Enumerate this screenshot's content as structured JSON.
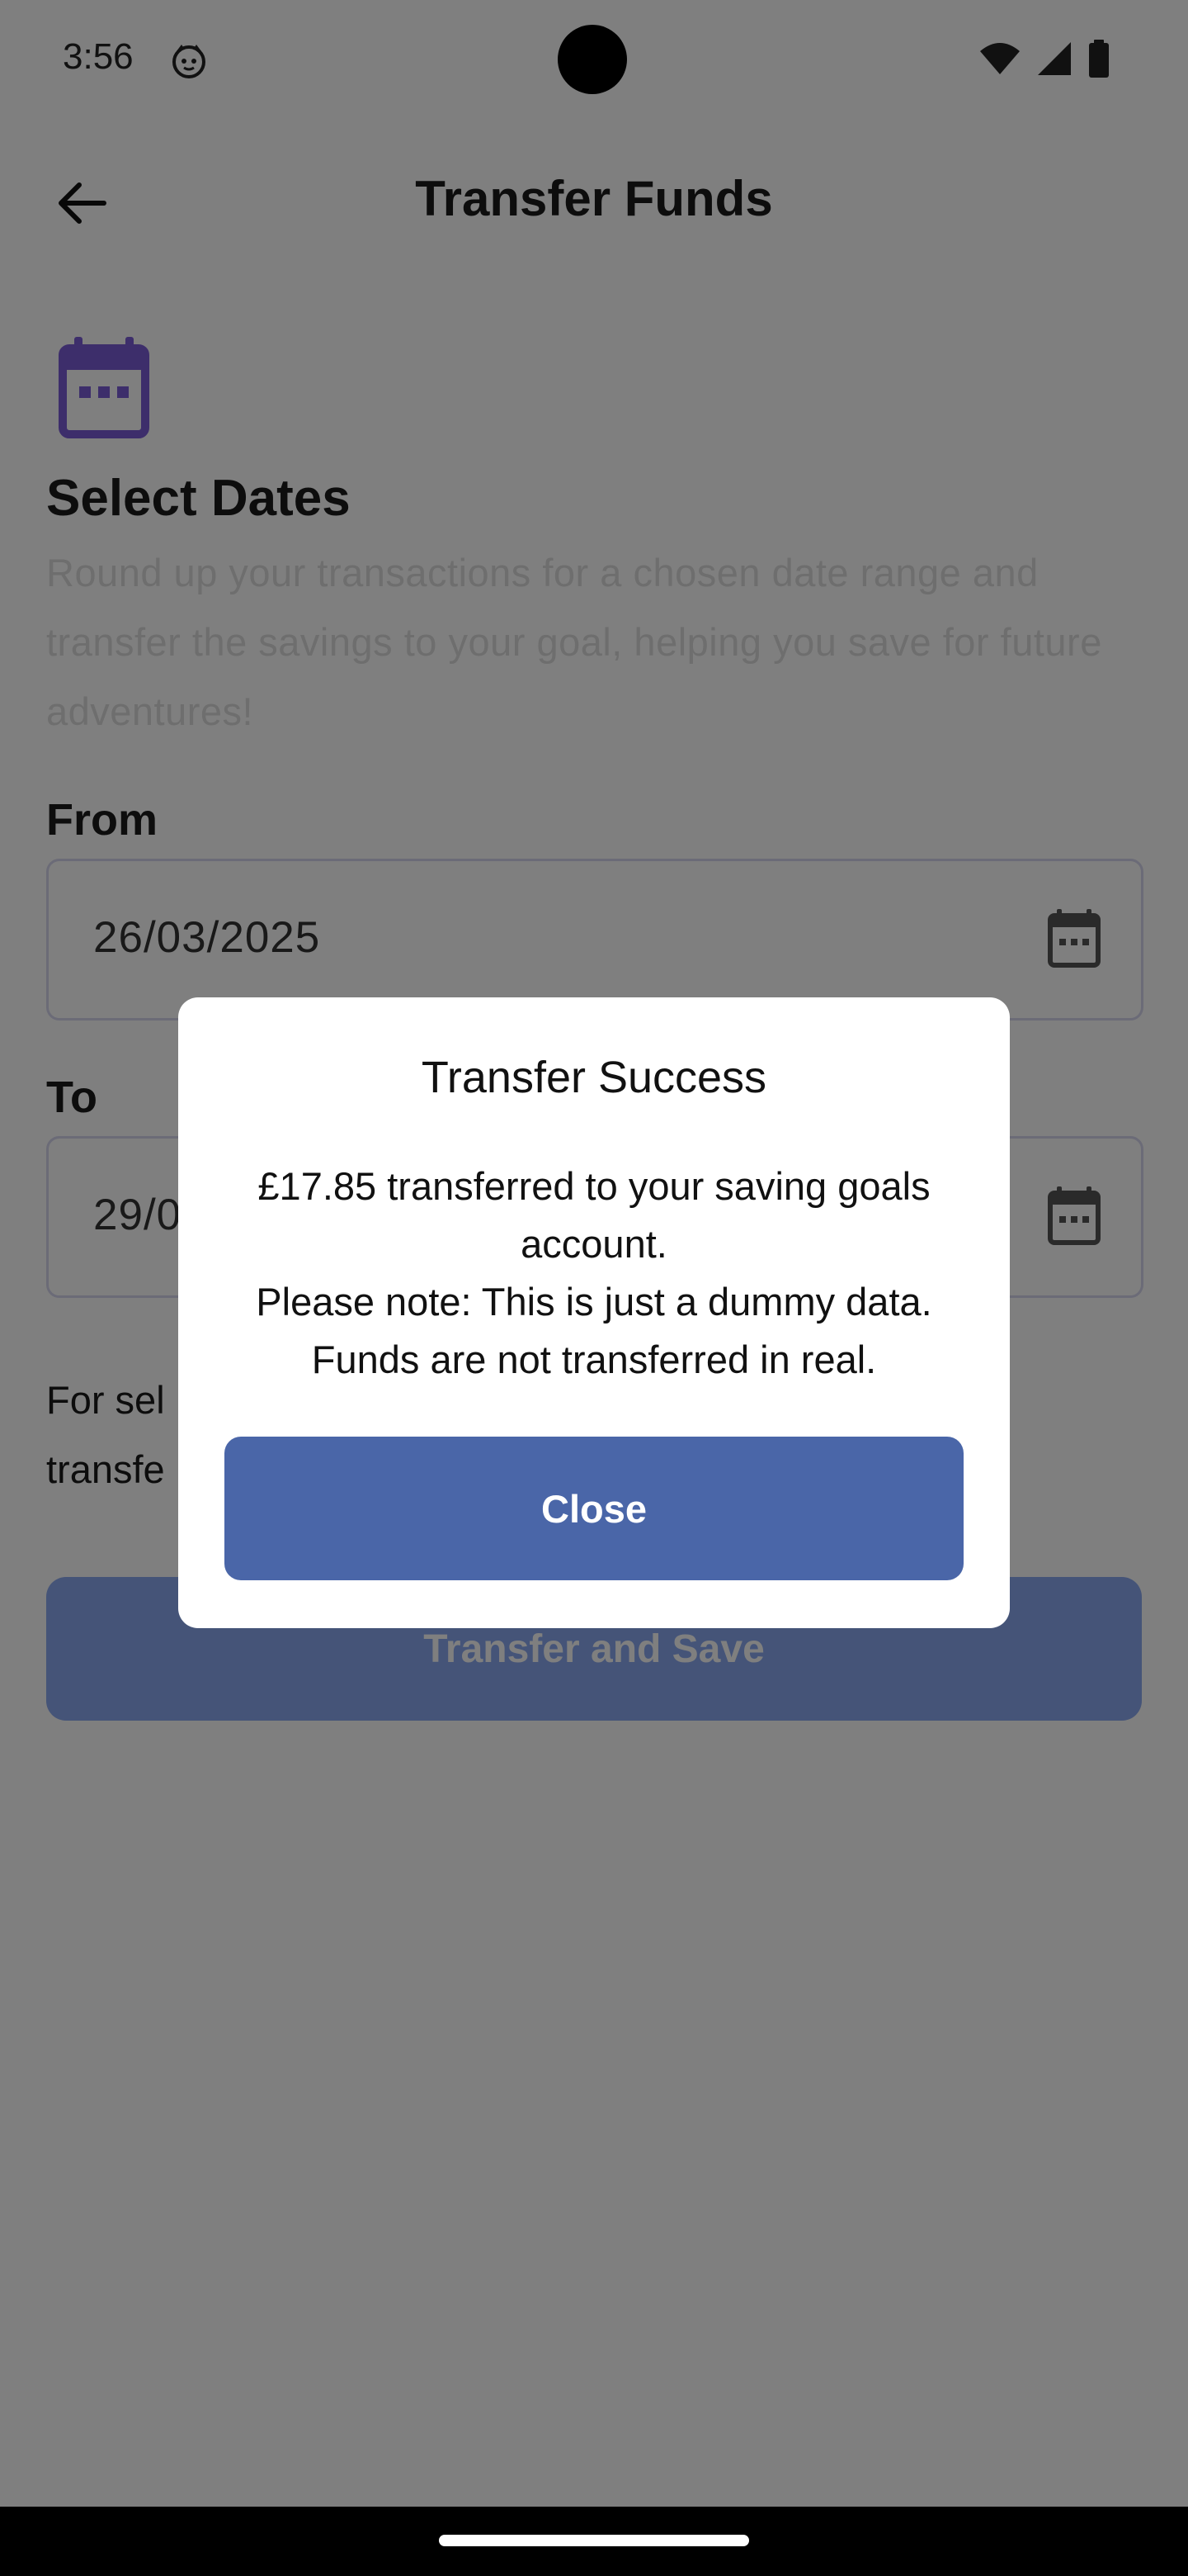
{
  "status_bar": {
    "time": "3:56",
    "app_icon": "cat-face-icon",
    "icons": [
      "wifi-icon",
      "signal-icon",
      "battery-icon"
    ]
  },
  "app_bar": {
    "title": "Transfer Funds",
    "back_icon": "arrow-back-icon"
  },
  "section": {
    "icon": "calendar-icon",
    "title": "Select Dates",
    "description": "Round up your transactions for a chosen date range and transfer the savings to your goal, helping you save for future adventures!"
  },
  "from_field": {
    "label": "From",
    "value": "26/03/2025",
    "icon": "calendar-icon"
  },
  "to_field": {
    "label": "To",
    "value": "29/0",
    "icon": "calendar-icon"
  },
  "info": {
    "line1": "For sel",
    "line2": "transfe"
  },
  "primary_button": {
    "label": "Transfer and Save"
  },
  "dialog": {
    "title": "Transfer Success",
    "line1": "£17.85 transferred to your saving goals account.",
    "line2": "Please note: This is just a dummy data.",
    "line3": "Funds are not transferred in real.",
    "button_label": "Close"
  },
  "colors": {
    "accent_purple": "#7b5cd6",
    "dialog_button": "#4a66a8",
    "primary_button": "#8aa8f0",
    "scrim": "rgba(0,0,0,0.5)"
  }
}
